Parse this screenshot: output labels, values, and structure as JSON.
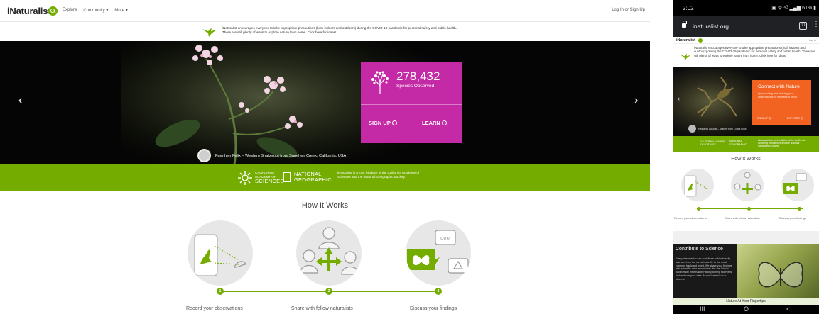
{
  "desktop": {
    "nav": {
      "logo": "iNaturalist",
      "links": [
        "Explore",
        "Community ▾",
        "More ▾"
      ],
      "login": "Log In or Sign Up"
    },
    "notice": "iNaturalist encourages everyone to take appropriate precautions (both indoors and outdoors) during the COVID-19 pandemic for personal safety and public health. There are still plenty of ways to explore nature from home. Click here for ideas!",
    "hero": {
      "prev_arrow": "‹",
      "next_arrow": "›",
      "species_count": "278,432",
      "species_label": "Species Observed",
      "signup_label": "SIGN UP",
      "learn_label": "LEARN",
      "photo_credit": "Faerthen Felix  –  Western Snakeroot from Sagehen Creek, California, USA"
    },
    "partners": {
      "cas_line1": "CALIFORNIA",
      "cas_line2": "ACADEMY OF",
      "cas_big": "SCIENCES",
      "ng_line1": "NATIONAL",
      "ng_line2": "GEOGRAPHIC",
      "note": "iNaturalist is a joint initiative of the California Academy of Sciences and the National Geographic Society."
    },
    "how_it_works": {
      "title": "How It Works",
      "steps": [
        {
          "number": "1",
          "label": "Record your observations"
        },
        {
          "number": "2",
          "label": "Share with fellow naturalists"
        },
        {
          "number": "3",
          "label": "Discuss your findings"
        }
      ]
    },
    "colors": {
      "brand_green": "#74ac00",
      "stat_magenta": "#c429a6"
    }
  },
  "phone": {
    "status_time": "2:02",
    "status_right": "▣ ᯤ ⁴ᴳ ▂▄▆ 61% ▮",
    "url": "inaturalist.org",
    "tab_count": ":D",
    "nav_logo": "iNaturalist",
    "nav_login": "Log In",
    "notice": "iNaturalist encourages everyone to take appropriate precautions (both indoors and outdoors) during the COVID-19 pandemic for personal safety and public health. There are still plenty of ways to explore nature from home. Click here for ideas!",
    "hero": {
      "box_title": "Connect with Nature",
      "box_sub": "by recording and sharing your observations of the natural world",
      "signup": "SIGN UP ◎",
      "explore": "EXPLORE ◎",
      "credit": "Reinaldo Aguilar – Mantis from Costa Rica"
    },
    "partners": {
      "cas": "CALIFORNIA ACADEMY OF SCIENCES",
      "ng": "NATIONAL GEOGRAPHIC",
      "note": "iNaturalist is a joint initiative of the California Academy of Sciences and the National Geographic Society."
    },
    "how_title": "How It Works",
    "steps": [
      "Record your observations",
      "Share with fellow naturalists",
      "Discuss your findings"
    ],
    "science": {
      "title": "Contribute to Science",
      "text": "Every observation can contribute to biodiversity science, from the rarest butterfly to the most common backyard weed. We share your findings with scientific data repositories like the Global Biodiversity Information Facility to help scientists find and use your data. All you have to do is observe."
    },
    "bottom_banner": "Nature At Your Fingertips",
    "navbar": [
      "III",
      "O",
      "<"
    ],
    "colors": {
      "orange_box": "#f26322"
    }
  }
}
